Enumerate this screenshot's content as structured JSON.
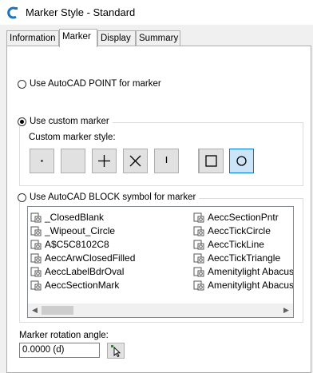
{
  "window": {
    "title": "Marker Style - Standard"
  },
  "tabs": [
    {
      "label": "Information"
    },
    {
      "label": "Marker"
    },
    {
      "label": "Display"
    },
    {
      "label": "Summary"
    }
  ],
  "options": {
    "point_label": "Use AutoCAD POINT for marker",
    "custom_label": "Use custom marker",
    "custom_style_label": "Custom marker style:",
    "block_label": "Use AutoCAD BLOCK symbol for marker"
  },
  "custom_styles": [
    "dot",
    "none",
    "plus",
    "x",
    "vertical-tick"
  ],
  "custom_modifiers": [
    "square",
    "circle"
  ],
  "blocks_left": [
    "_ClosedBlank",
    "_Wipeout_Circle",
    "A$C5C8102C8",
    "AeccArwClosedFilled",
    "AeccLabelBdrOval",
    "AeccSectionMark"
  ],
  "blocks_right": [
    "AeccSectionPntr",
    "AeccTickCircle",
    "AeccTickLine",
    "AeccTickTriangle",
    "Amenitylight Abacus",
    "Amenitylight Abacus"
  ],
  "rotation": {
    "label": "Marker rotation angle:",
    "value": "0.0000 (d)"
  }
}
